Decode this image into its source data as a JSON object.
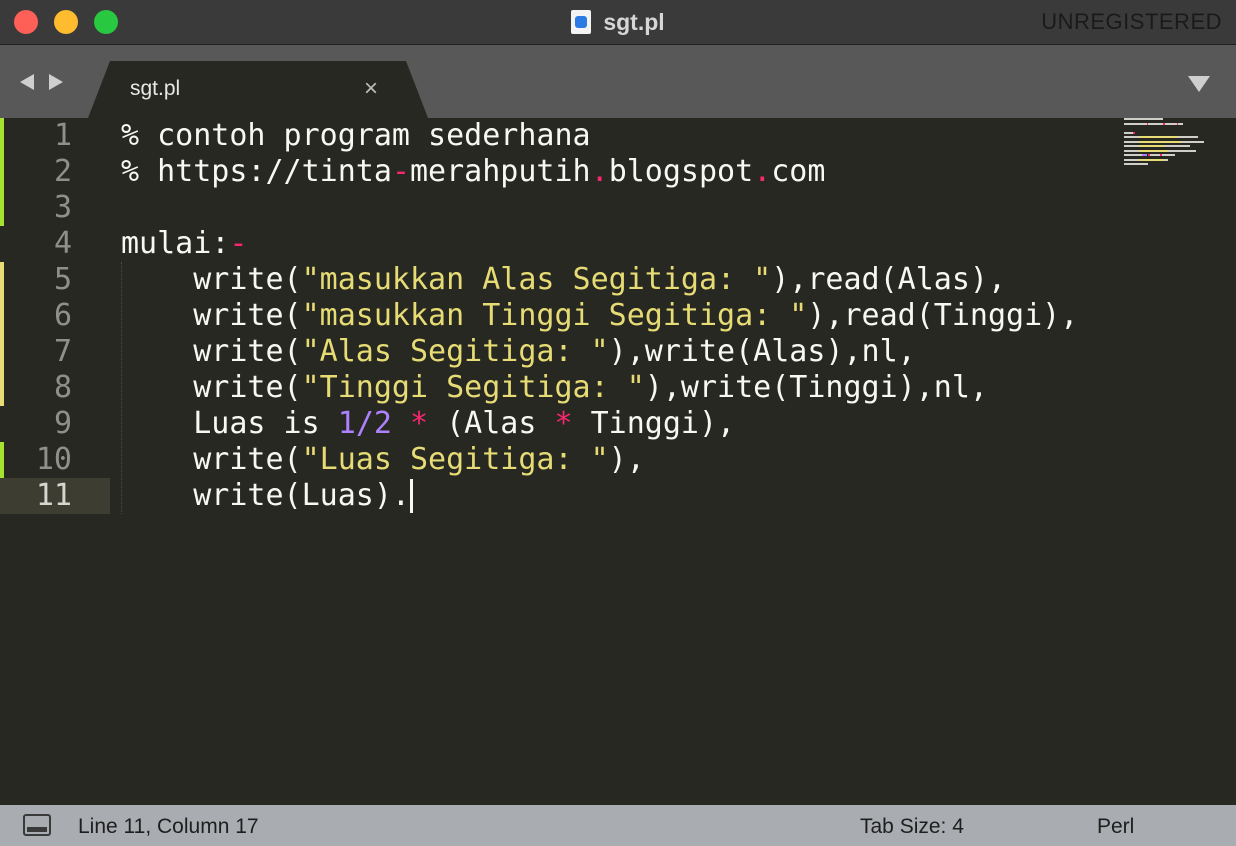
{
  "window": {
    "title": "sgt.pl",
    "registration": "UNREGISTERED",
    "file_icon": "document-icon"
  },
  "tabs": [
    {
      "label": "sgt.pl",
      "active": true,
      "close_glyph": "×"
    }
  ],
  "navigation": {
    "back_icon": "chevron-left-icon",
    "forward_icon": "chevron-right-icon",
    "menu_icon": "triangle-down-icon"
  },
  "editor": {
    "active_line": 11,
    "colors": {
      "background": "#272822",
      "keyword": "#66d9ef",
      "string": "#e6db74",
      "number": "#ae81ff",
      "operator": "#f92672",
      "text": "#f8f8f2",
      "git_added": "#a6e22e",
      "git_modified": "#e6db74"
    },
    "lines": [
      {
        "n": "1",
        "text": "% contoh program sederhana"
      },
      {
        "n": "2",
        "text": "% https://tinta-merahputih.blogspot.com"
      },
      {
        "n": "3",
        "text": ""
      },
      {
        "n": "4",
        "text": "mulai:-"
      },
      {
        "n": "5",
        "text": "    write(\"masukkan Alas Segitiga: \"),read(Alas),"
      },
      {
        "n": "6",
        "text": "    write(\"masukkan Tinggi Segitiga: \"),read(Tinggi),"
      },
      {
        "n": "7",
        "text": "    write(\"Alas Segitiga: \"),write(Alas),nl,"
      },
      {
        "n": "8",
        "text": "    write(\"Tinggi Segitiga: \"),write(Tinggi),nl,"
      },
      {
        "n": "9",
        "text": "    Luas is 1/2 * (Alas * Tinggi),"
      },
      {
        "n": "10",
        "text": "    write(\"Luas Segitiga: \"),"
      },
      {
        "n": "11",
        "text": "    write(Luas)."
      }
    ]
  },
  "status": {
    "panel_icon": "panel-toggle-icon",
    "position": "Line 11, Column 17",
    "tab_size": "Tab Size: 4",
    "syntax": "Perl"
  }
}
